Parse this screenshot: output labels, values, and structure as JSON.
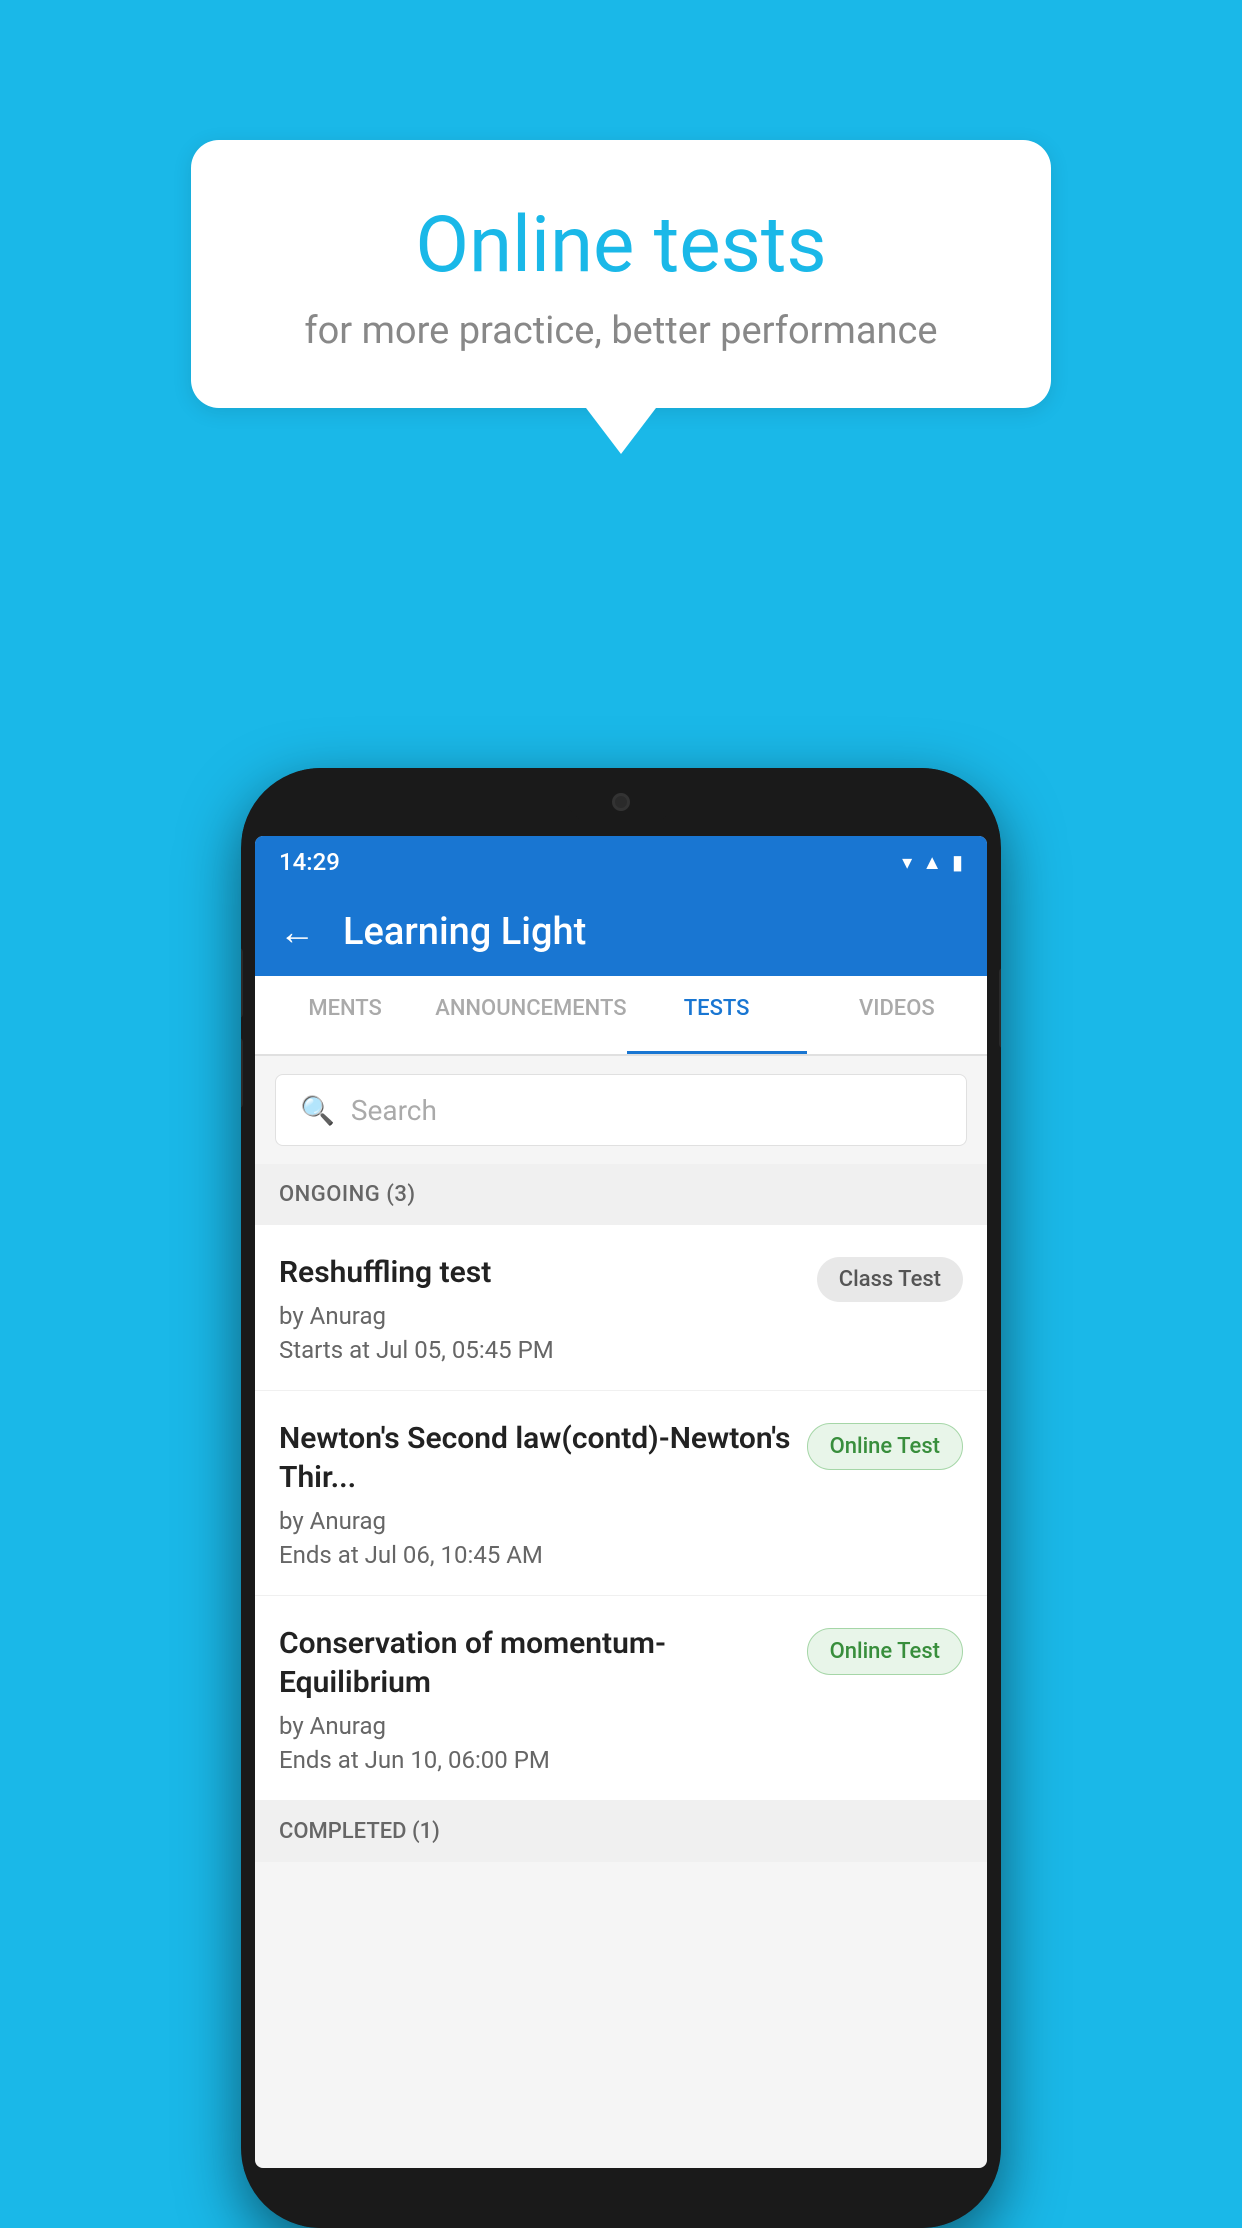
{
  "background_color": "#1ab8e8",
  "speech_bubble": {
    "title": "Online tests",
    "subtitle": "for more practice, better performance"
  },
  "phone": {
    "status_bar": {
      "time": "14:29",
      "icons": [
        "wifi",
        "signal",
        "battery"
      ]
    },
    "app_bar": {
      "back_label": "←",
      "title": "Learning Light"
    },
    "tabs": [
      {
        "label": "MENTS",
        "active": false
      },
      {
        "label": "ANNOUNCEMENTS",
        "active": false
      },
      {
        "label": "TESTS",
        "active": true
      },
      {
        "label": "VIDEOS",
        "active": false
      }
    ],
    "search": {
      "placeholder": "Search"
    },
    "ongoing_section": {
      "header": "ONGOING (3)",
      "items": [
        {
          "name": "Reshuffling test",
          "by": "by Anurag",
          "time_label": "Starts at",
          "time": "Jul 05, 05:45 PM",
          "badge": "Class Test",
          "badge_type": "class"
        },
        {
          "name": "Newton's Second law(contd)-Newton's Thir...",
          "by": "by Anurag",
          "time_label": "Ends at",
          "time": "Jul 06, 10:45 AM",
          "badge": "Online Test",
          "badge_type": "online"
        },
        {
          "name": "Conservation of momentum-Equilibrium",
          "by": "by Anurag",
          "time_label": "Ends at",
          "time": "Jun 10, 06:00 PM",
          "badge": "Online Test",
          "badge_type": "online"
        }
      ]
    },
    "completed_section": {
      "header": "COMPLETED (1)"
    }
  }
}
